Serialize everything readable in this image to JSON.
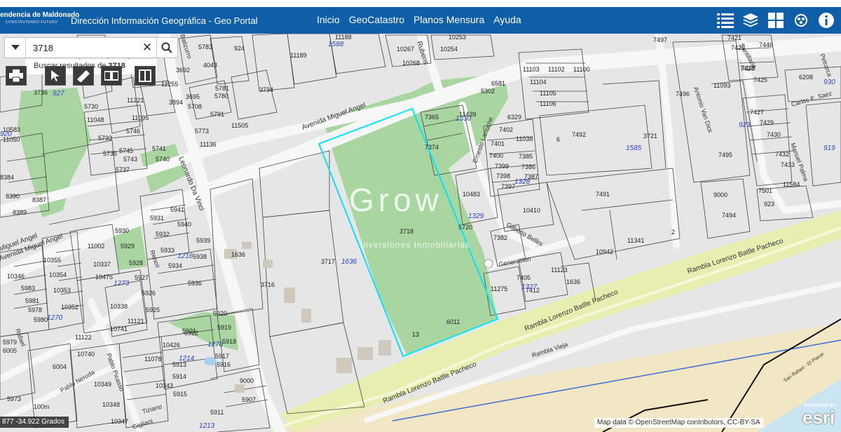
{
  "header": {
    "brand": "endencia de Maldonado",
    "brand_sub": "CONSTRUYENDO FUTURO",
    "title": "Dirección Información Geográfica -  Geo Portal",
    "nav": [
      "Inicio",
      "GeoCatastro",
      "Planos Mensura",
      "Ayuda"
    ],
    "tool_icons": [
      "list-icon",
      "layers-icon",
      "grid-icon",
      "basemap-icon",
      "info-icon"
    ]
  },
  "search": {
    "value": "3718",
    "results_prefix": "Buscar resultados de",
    "results_term": "3718"
  },
  "map_tools": [
    "print-icon",
    "pointer-icon",
    "measure-icon",
    "compare-icon",
    "split-icon"
  ],
  "map": {
    "streets": [
      "Avenida Miguel Angel",
      "Avenida Miguel Angel",
      "Leonardo Da Vinci",
      "Rubens",
      "Ernesto Larroche",
      "Gilberto Bellini",
      "Generacion",
      "Rambla Lorenzo Batlle Pacheco",
      "Rambla Lorenzo Batlle Pacheco",
      "Rambla Lorenzo Batlle Pacheco",
      "Rambla Vieja",
      "Antonio Van Dick",
      "Carlos E. Saez",
      "Pablo Neruda",
      "Pablo Picasso",
      "Rafael",
      "Renoir",
      "Batizurro",
      "Santillana",
      "Petrarca",
      "Manuel Palma",
      "Miguel Angel",
      "Tiziano",
      "San Rafael - El Placer",
      "100m",
      "Gigliani"
    ],
    "parcels": [
      "11188",
      "10253",
      "10267",
      "10254",
      "10268",
      "11189",
      "924",
      "3734",
      "5783",
      "4043",
      "3692",
      "11255",
      "5781",
      "3695",
      "5780",
      "3894",
      "5708",
      "5791",
      "11505",
      "5773",
      "11136",
      "11221",
      "11095",
      "5746",
      "3736",
      "5730",
      "11048",
      "5733",
      "5735",
      "5745",
      "5743",
      "5741",
      "5740",
      "5737",
      "10583",
      "11050",
      "8384",
      "8390",
      "8387",
      "8389",
      "11103",
      "11102",
      "11100",
      "11104",
      "11105",
      "11106",
      "7497",
      "7421",
      "7422",
      "7446",
      "7423",
      "7424",
      "7425",
      "6208",
      "11093",
      "7496",
      "7427",
      "7429",
      "7430",
      "7432",
      "7433",
      "11584",
      "7501",
      "923",
      "7492",
      "3721",
      "6",
      "7495",
      "9000",
      "7494",
      "7491",
      "10942",
      "11341",
      "2",
      "7365",
      "11439",
      "5302",
      "6581",
      "6329",
      "7374",
      "7402",
      "11038",
      "7401",
      "7400",
      "7385",
      "7399",
      "7386",
      "7398",
      "7387",
      "7397",
      "10483",
      "10410",
      "5720",
      "7382",
      "11123",
      "7405",
      "7412",
      "1636",
      "11275",
      "3718",
      "3717",
      "3716",
      "5930",
      "5929",
      "5941",
      "5931",
      "5940",
      "5932",
      "5933",
      "5939",
      "5934",
      "5938",
      "5928",
      "5936",
      "5927",
      "5926",
      "5925",
      "5920",
      "5919",
      "5921",
      "5918",
      "5922",
      "10426",
      "11078",
      "5917",
      "5913",
      "5914",
      "5916",
      "10343",
      "5915",
      "9000",
      "5907",
      "5911",
      "11002",
      "10355",
      "10337",
      "10354",
      "10475",
      "10353",
      "10352",
      "10338",
      "10741",
      "11121",
      "11122",
      "10740",
      "10349",
      "10348",
      "10347",
      "10346",
      "5983",
      "5981",
      "5980",
      "5978",
      "5979",
      "6005",
      "6004",
      "5973",
      "6011",
      "13",
      "1636",
      "3716"
    ],
    "blocks": [
      "1588",
      "927",
      "920",
      "1330",
      "1328",
      "1329",
      "1585",
      "923",
      "919",
      "1636",
      "1327",
      "1273",
      "1216",
      "1270",
      "1270",
      "1214",
      "1213",
      "930"
    ],
    "selected_parcel": "3718",
    "watermark": "Grow",
    "watermark_sub": "Inversiones Inmobiliarias",
    "colors": {
      "header": "#0f5ea8",
      "parcel_bg": "#e6e6e6",
      "green": "#a9d6a0",
      "road": "#f5f5f5",
      "rambla": "#e8eeb0",
      "sand": "#f2e7c4",
      "sea": "#c9e4f3",
      "highlight": "#00e6ff",
      "block_label": "#2a46c9"
    }
  },
  "status": {
    "coords": "877 -34.922 Grados",
    "attribution": "Map data © OpenStreetMap contributors, CC-BY-SA",
    "powered": "POWERED BY",
    "esri": "esri"
  }
}
